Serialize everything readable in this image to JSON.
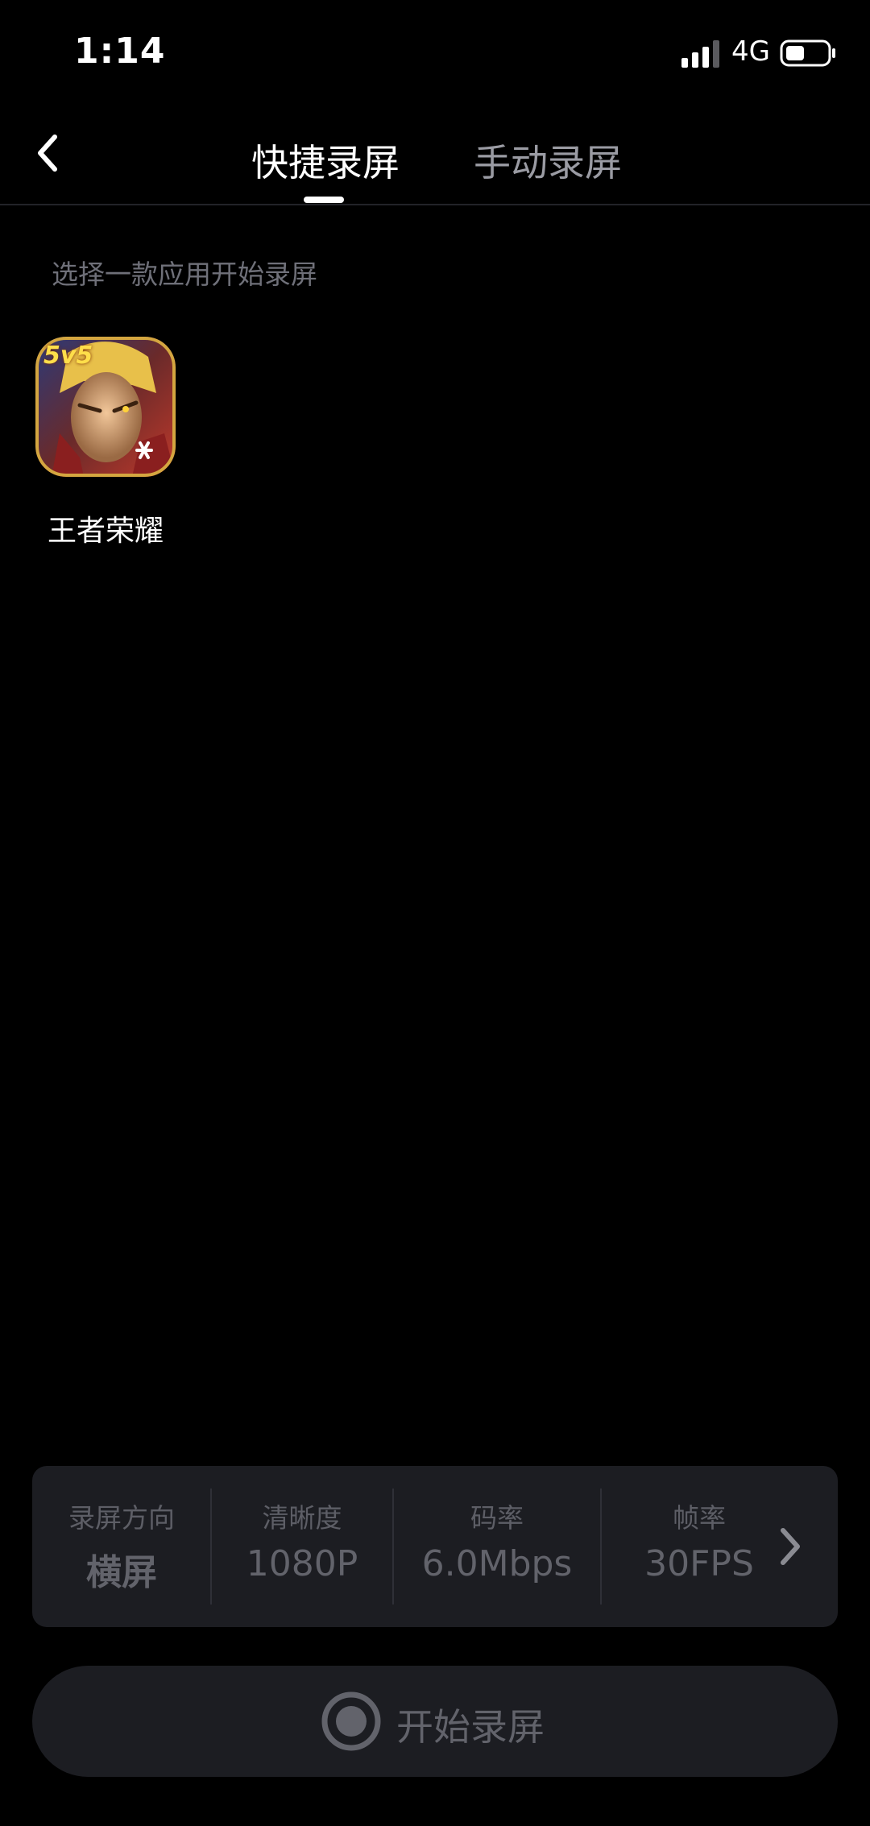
{
  "status_bar": {
    "time": "1:14",
    "network": "4G"
  },
  "nav": {
    "tabs": [
      {
        "label": "快捷录屏",
        "active": true
      },
      {
        "label": "手动录屏",
        "active": false
      }
    ]
  },
  "hint": "选择一款应用开始录屏",
  "apps": [
    {
      "name": "王者荣耀",
      "badge": "5v5"
    }
  ],
  "settings": [
    {
      "label": "录屏方向",
      "value": "横屏"
    },
    {
      "label": "清晰度",
      "value": "1080P"
    },
    {
      "label": "码率",
      "value": "6.0Mbps"
    },
    {
      "label": "帧率",
      "value": "30FPS"
    }
  ],
  "start_button": {
    "label": "开始录屏"
  },
  "colors": {
    "background": "#000000",
    "panel": "#1c1d22",
    "muted_text": "#62636b",
    "inactive_tab": "#9a9ba3"
  }
}
